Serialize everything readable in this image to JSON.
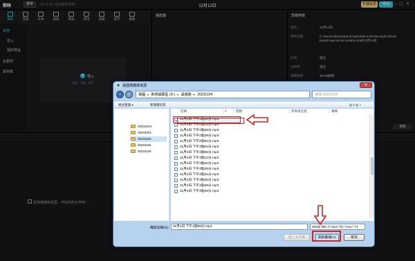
{
  "editor": {
    "app_name": "剪映",
    "menu_label": "菜单",
    "autosave": "06:11:32 自动保存本地",
    "project_title": "12月12日",
    "upgrade_label": "开通会员",
    "export_label": "导出",
    "tools": [
      "媒体",
      "音频",
      "文本",
      "贴纸",
      "特效",
      "转场",
      "滤镜",
      "调节",
      "模板"
    ],
    "sidebar": [
      "本地",
      "导入",
      "我的预设",
      "云素材",
      "素材库"
    ],
    "import_label": "导入",
    "import_hint": "视频、音频、图片",
    "player_header": "播放器",
    "props_header": "草稿参数",
    "props": [
      {
        "label": "名称：",
        "value": "12月12日"
      },
      {
        "label": "保存位置：",
        "value": "C:/Users/Administrator/AppData/Local/JianyingPro/User Data/Projects/com.lveditor.draft/12月12日"
      },
      {
        "label": "比例：",
        "value": "适应"
      },
      {
        "label": "分辨率：",
        "value": "适应"
      },
      {
        "label": "草稿帧率：",
        "value": "30.00帧/秒"
      },
      {
        "label": "导入方式：",
        "value": "保留在原有位置"
      }
    ],
    "edit_label": "修改",
    "timeline_hint": "素材拖拽到这里，开始你的大作吧~"
  },
  "dialog": {
    "title": "请选择媒体资源",
    "breadcrumb": [
      "電腦",
      "新增磁碟區 (D:)",
      "黑暗歌",
      "20231104"
    ],
    "search_placeholder": "搜尋 20231104",
    "organize_label": "組合管理 ▾",
    "new_folder_label": "新增資料夾",
    "folders": [
      "20231014",
      "20231021",
      "20231104",
      "20231118",
      "20231125"
    ],
    "selected_folder": "20231104",
    "columns": [
      "名稱",
      "#",
      "標題",
      "參與演出者",
      "專輯"
    ],
    "files": [
      "11月4日 下午1點59分.mp3",
      "11月4日 下午2點15分.mp3",
      "11月4日 下午2點28分.mp3",
      "11月4日 下午2點39分.mp3",
      "11月4日 下午2點51分.mp3",
      "11月4日 下午3點02分.mp3",
      "11月4日 下午3點05分.mp3",
      "11月4日 下午3點12分.mp3",
      "11月4日 下午3點22分.mp3",
      "11月4日 下午3點26分.mp3",
      "11月4日 下午3點31分.mp3",
      "11月4日 下午3點35分.mp3",
      "11月4日 下午3點39分.mp3",
      "11月4日 下午3點45分.mp3"
    ],
    "filename_label": "檔案名稱(N):",
    "filename_value": "11月4日 下午1點59分.mp3",
    "filetype_value": "Media files (*.mp4;*.flv;*.mov;*.f ▾",
    "import_string_label": "匯入文字串",
    "open_label": "開啟舊檔(O)",
    "cancel_label": "取消"
  },
  "colors": {
    "accent": "#2ec4d6",
    "annotation_red": "#d9201f",
    "dialog_frame": "#b7d2ee"
  }
}
